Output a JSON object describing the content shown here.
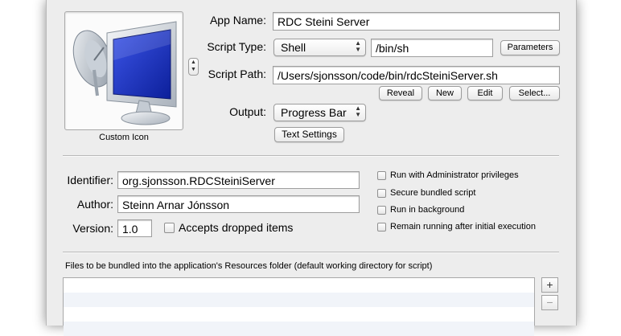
{
  "icon": {
    "caption": "Custom Icon",
    "name": "screen-with-satellite-dish-icon"
  },
  "fields": {
    "app_name": {
      "label": "App Name:",
      "value": "RDC Steini Server"
    },
    "script_type": {
      "label": "Script Type:",
      "selected": "Shell",
      "interpreter": "/bin/sh",
      "parameters_label": "Parameters"
    },
    "script_path": {
      "label": "Script Path:",
      "value": "/Users/sjonsson/code/bin/rdcSteiniServer.sh"
    },
    "output": {
      "label": "Output:",
      "selected": "Progress Bar",
      "text_settings_label": "Text Settings"
    }
  },
  "path_buttons": {
    "reveal": "Reveal",
    "new": "New",
    "edit": "Edit",
    "select": "Select..."
  },
  "meta": {
    "identifier": {
      "label": "Identifier:",
      "value": "org.sjonsson.RDCSteiniServer"
    },
    "author": {
      "label": "Author:",
      "value": "Steinn Arnar Jónsson"
    },
    "version": {
      "label": "Version:",
      "value": "1.0"
    },
    "accepts_dropped": {
      "label": "Accepts dropped items",
      "checked": false
    }
  },
  "options": [
    {
      "label": "Run with Administrator privileges",
      "checked": false
    },
    {
      "label": "Secure bundled script",
      "checked": false
    },
    {
      "label": "Run in background",
      "checked": false
    },
    {
      "label": "Remain running after initial execution",
      "checked": false
    }
  ],
  "bundled": {
    "label": "Files to be bundled into the application's Resources folder (default working directory for script)",
    "add_label": "+",
    "remove_label": "−"
  },
  "colors": {
    "window_bg": "#ededed",
    "screen_blue": "#1a35c8",
    "list_alt": "#f1f4f9"
  }
}
